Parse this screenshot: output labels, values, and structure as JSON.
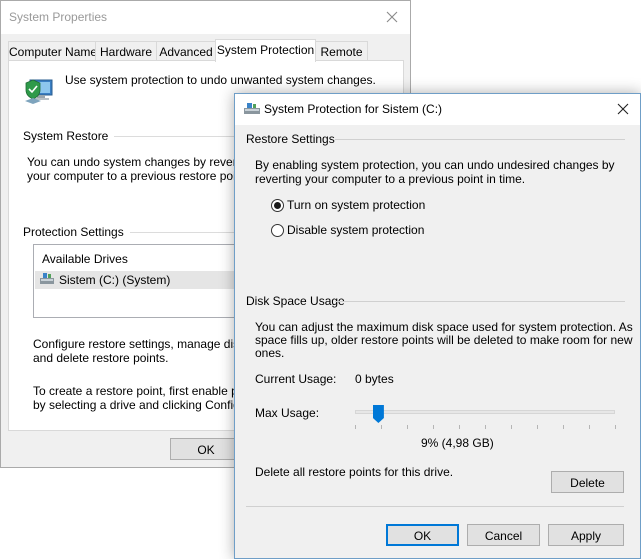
{
  "system_properties": {
    "title": "System Properties",
    "tabs": [
      {
        "label": "Computer Name"
      },
      {
        "label": "Hardware"
      },
      {
        "label": "Advanced"
      },
      {
        "label": "System Protection"
      },
      {
        "label": "Remote"
      }
    ],
    "intro_text": "Use system protection to undo unwanted system changes.",
    "system_restore": {
      "label": "System Restore",
      "text_line1": "You can undo system changes by reverting",
      "text_line2": "your computer to a previous restore point."
    },
    "protection_settings": {
      "label": "Protection Settings",
      "drives_header": "Available Drives",
      "drives": [
        {
          "name": "Sistem (C:) (System)"
        }
      ],
      "configure_line1": "Configure restore settings, manage disk spa",
      "configure_line2": "and delete restore points.",
      "create_line1": "To create a restore point, first enable protec",
      "create_line2": "by selecting a drive and clicking Configure."
    },
    "ok_label": "OK"
  },
  "dialog": {
    "title": "System Protection for Sistem (C:)",
    "restore_settings": {
      "label": "Restore Settings",
      "description_line1": "By enabling system protection, you can undo undesired changes by",
      "description_line2": "reverting your computer to a previous point in time.",
      "options": [
        {
          "label": "Turn on system protection",
          "selected": true
        },
        {
          "label": "Disable system protection",
          "selected": false
        }
      ]
    },
    "disk_space": {
      "label": "Disk Space Usage",
      "description_line1": "You can adjust the maximum disk space used for system protection. As",
      "description_line2": "space fills up, older restore points will be deleted to make room for new",
      "description_line3": "ones.",
      "current_usage_label": "Current Usage:",
      "current_usage_value": "0 bytes",
      "max_usage_label": "Max Usage:",
      "max_usage_percent": 9,
      "max_usage_text": "9% (4,98 GB)",
      "delete_text": "Delete all restore points for this drive.",
      "delete_label": "Delete"
    },
    "buttons": {
      "ok": "OK",
      "cancel": "Cancel",
      "apply": "Apply"
    }
  },
  "colors": {
    "accent": "#0078d7",
    "window_bg": "#f0f0f0",
    "selection_row": "#e5e5e5"
  },
  "icons": {
    "window_close": "close-icon",
    "system_protection": "computer-shield-icon",
    "drive": "hard-drive-icon"
  }
}
